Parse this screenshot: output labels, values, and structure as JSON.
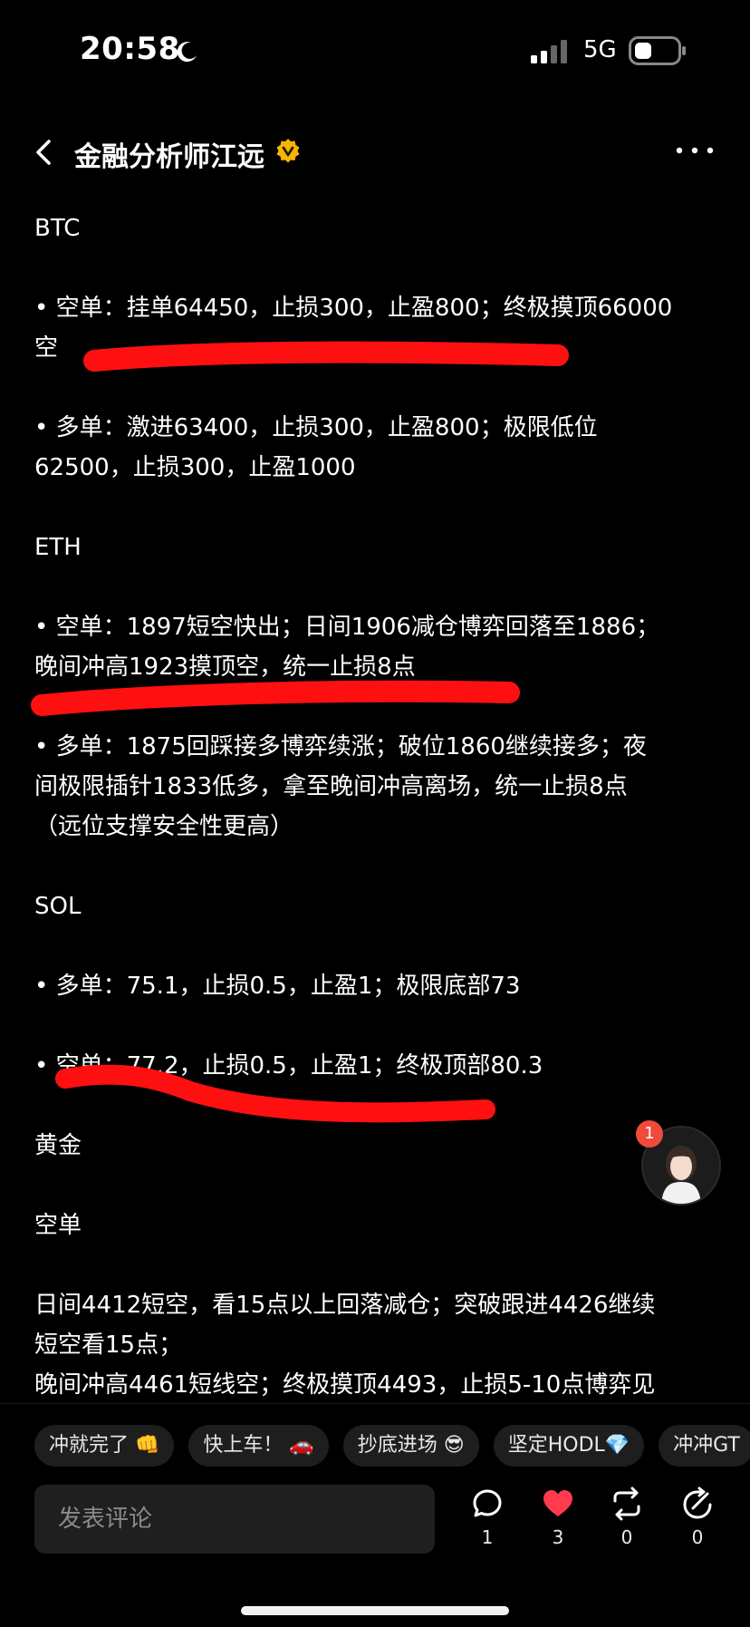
{
  "status_bar": {
    "time": "20:58",
    "network": "5G",
    "icons": [
      "moon-icon",
      "signal-icon",
      "battery-icon"
    ]
  },
  "header": {
    "title": "金融分析师江远",
    "icons": [
      "back-icon",
      "verified-icon",
      "more-icon"
    ]
  },
  "post": {
    "lines": [
      "BTC",
      "• 空单：挂单64450，止损300，止盈800；终极摸顶66000",
      "空",
      "• 多单：激进63400，止损300，止盈800；极限低位",
      "62500，止损300，止盈1000",
      "ETH",
      "• 空单：1897短空快出；日间1906减仓博弈回落至1886；",
      "晚间冲高1923摸顶空，统一止损8点",
      "• 多单：1875回踩接多博弈续涨；破位1860继续接多；夜",
      "间极限插针1833低多，拿至晚间冲高离场，统一止损8点",
      "（远位支撑安全性更高）",
      "SOL",
      "• 多单：75.1，止损0.5，止盈1；极限底部73",
      "• 空单：77.2，止损0.5，止盈1；终极顶部80.3",
      "黄金",
      "空单",
      "日间4412短空，看15点以上回落减仓；突破跟进4426继续",
      "短空看15点；",
      "晚间冲高4461短线空；终极摸顶4493，止损5-10点博弈见"
    ],
    "highlight_color": "#ff1010"
  },
  "floating_avatar": {
    "badge": "1"
  },
  "quick_replies": [
    "冲就完了 👊",
    "快上车！ 🚗",
    "抄底进场 😎",
    "坚定HODL💎",
    "冲冲GT"
  ],
  "bottom_bar": {
    "comment_placeholder": "发表评论",
    "comments": "1",
    "likes": "3",
    "reposts": "0",
    "shares": "0"
  },
  "colors": {
    "background": "#000000",
    "like": "#ff3b4e",
    "verified": "#f5b400"
  }
}
